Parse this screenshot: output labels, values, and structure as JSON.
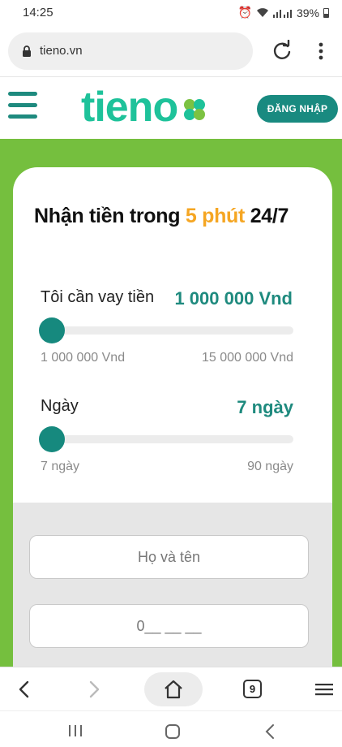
{
  "status": {
    "time": "14:25",
    "battery": "39%"
  },
  "browser": {
    "url": "tieno.vn",
    "tab_count": "9"
  },
  "header": {
    "logo_text": "tieno",
    "login_label": "ĐĂNG NHẬP"
  },
  "hero": {
    "title_pre": "Nhận tiền trong ",
    "title_highlight": "5 phút",
    "title_post": " 24/7"
  },
  "amount": {
    "label": "Tôi cần vay tiền",
    "value": "1 000 000 Vnd",
    "min_label": "1 000 000 Vnd",
    "max_label": "15 000 000 Vnd",
    "current": 1000000,
    "min": 1000000,
    "max": 15000000
  },
  "days": {
    "label": "Ngày",
    "value": "7 ngày",
    "min_label": "7 ngày",
    "max_label": "90 ngày",
    "current": 7,
    "min": 7,
    "max": 90
  },
  "form": {
    "name_placeholder": "Họ và tên",
    "phone_placeholder": "0__ __ __"
  },
  "colors": {
    "brand": "#198a80",
    "hero_bg": "#75bf3e",
    "highlight": "#f5a623"
  }
}
